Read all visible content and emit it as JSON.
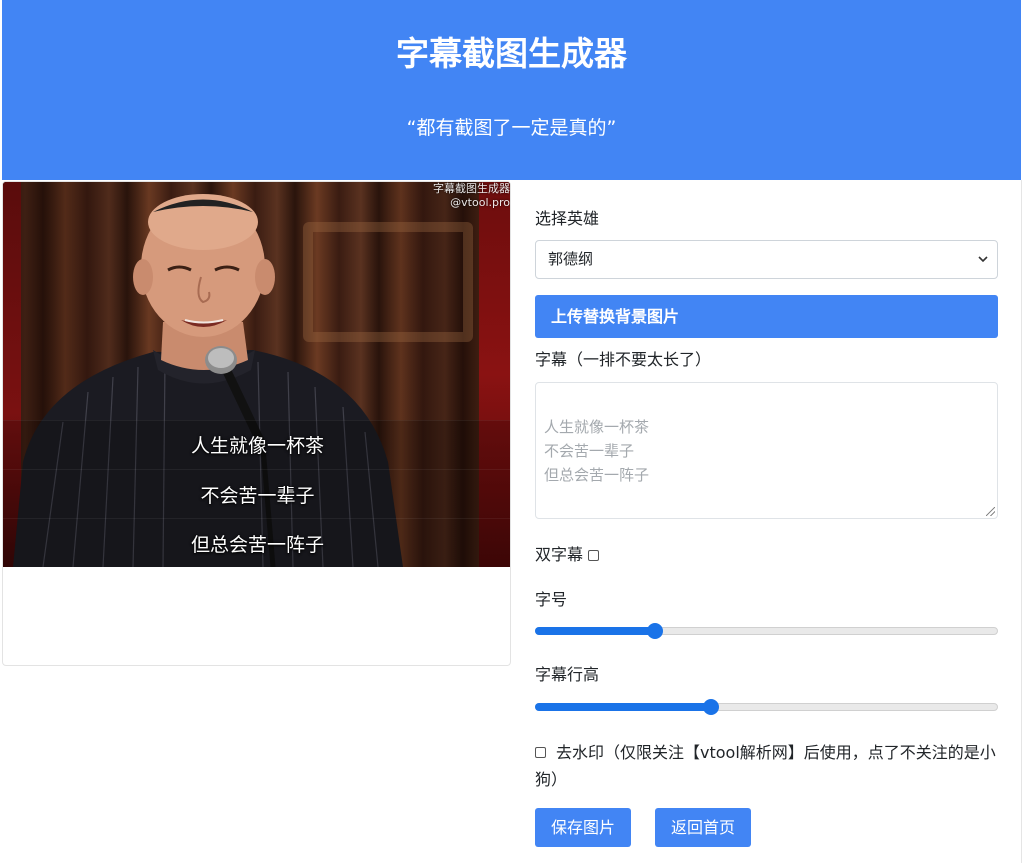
{
  "header": {
    "title": "字幕截图生成器",
    "tagline": "“都有截图了一定是真的”"
  },
  "preview": {
    "watermark_line1": "字幕截图生成器",
    "watermark_line2": "@vtool.pro",
    "subtitles": [
      "人生就像一杯茶",
      "不会苦一辈子",
      "但总会苦一阵子"
    ]
  },
  "form": {
    "hero_label": "选择英雄",
    "hero_selected": "郭德纲",
    "upload_label": "上传替换背景图片",
    "subtitle_label": "字幕（一排不要太长了）",
    "subtitle_placeholder": "人生就像一杯茶\n不会苦一辈子\n但总会苦一阵子",
    "dual_label": "双字幕",
    "font_size_label": "字号",
    "font_size_value": 0.26,
    "line_height_label": "字幕行高",
    "line_height_value": 0.38,
    "watermark_label": "去水印（仅限关注【vtool解析网】后使用，点了不关注的是小狗）",
    "save_label": "保存图片",
    "home_label": "返回首页"
  },
  "colors": {
    "accent": "#4285f4",
    "slider": "#1a73e8"
  }
}
